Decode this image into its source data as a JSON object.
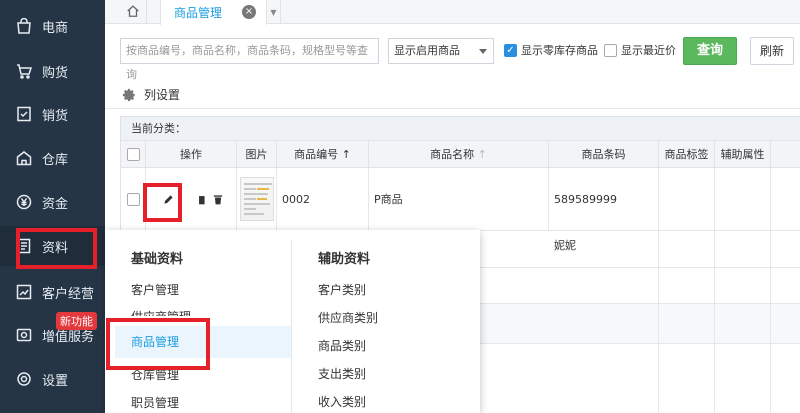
{
  "sidebar": {
    "items": [
      {
        "label": "电商",
        "icon": "shopping-bag-icon"
      },
      {
        "label": "购货",
        "icon": "cart-icon"
      },
      {
        "label": "销货",
        "icon": "sales-doc-icon"
      },
      {
        "label": "仓库",
        "icon": "warehouse-icon"
      },
      {
        "label": "资金",
        "icon": "yen-icon"
      },
      {
        "label": "资料",
        "icon": "document-icon"
      },
      {
        "label": "客户经营",
        "icon": "chart-icon"
      },
      {
        "label": "增值服务",
        "icon": "value-added-icon"
      },
      {
        "label": "设置",
        "icon": "gear-icon"
      }
    ],
    "new_badge": "新功能"
  },
  "tabs": {
    "home_icon": "home-icon",
    "active_label": "商品管理",
    "close_symbol": "×"
  },
  "toolbar": {
    "search_placeholder": "按商品编号，商品名称，商品条码，规格型号等查询",
    "filter_select": "显示启用商品",
    "show_zero_stock": "显示零库存商品",
    "show_zero_stock_checked": true,
    "show_recent_price": "显示最近价",
    "show_recent_price_checked": false,
    "query_button": "查询",
    "refresh_button": "刷新",
    "column_settings": "列设置"
  },
  "grid": {
    "current_category_label": "当前分类：",
    "headers": {
      "action": "操作",
      "image": "图片",
      "code": "商品编号",
      "code_sort": "↑",
      "name": "商品名称",
      "name_sort": "↑",
      "barcode": "商品条码",
      "tag": "商品标签",
      "aux": "辅助属性"
    },
    "rows": [
      {
        "code": "0002",
        "name": "P商品",
        "barcode": "589589999"
      },
      {
        "code": "",
        "name": "",
        "barcode": "妮妮"
      }
    ]
  },
  "popup": {
    "basic_title": "基础资料",
    "basic_items": [
      "客户管理",
      "供应商管理",
      "商品管理",
      "仓库管理",
      "职员管理"
    ],
    "aux_title": "辅助资料",
    "aux_items": [
      "客户类别",
      "供应商类别",
      "商品类别",
      "支出类别",
      "收入类别"
    ]
  },
  "colors": {
    "sidebar_bg": "#263545",
    "accent": "#1a9de0",
    "query_green": "#5bb85d",
    "annotation_red": "#e5202a"
  }
}
